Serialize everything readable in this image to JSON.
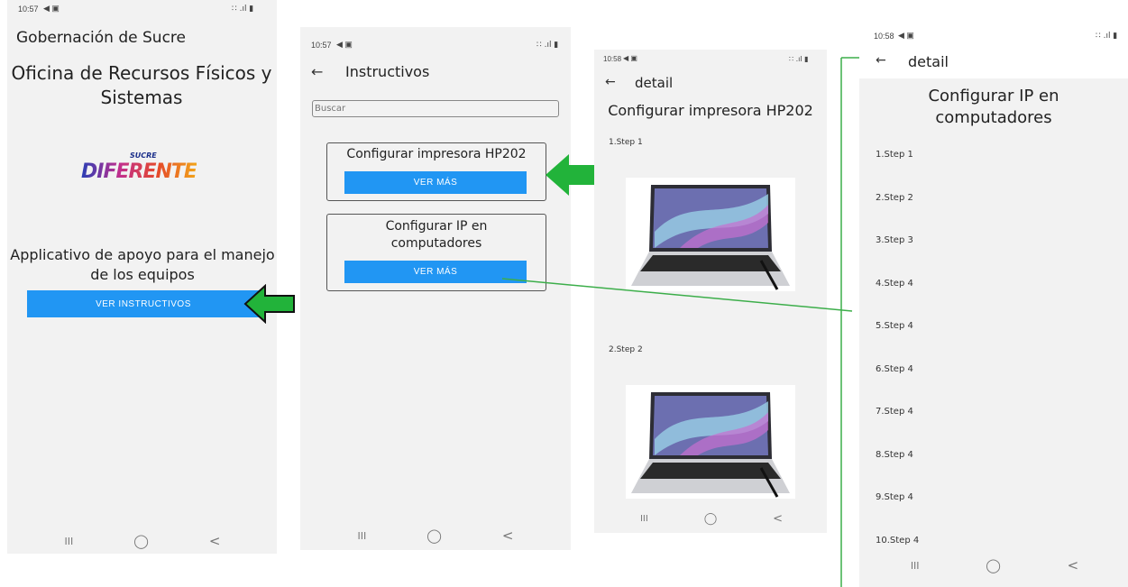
{
  "screen1": {
    "time": "10:57",
    "status_icons": "∷ .ıl ▮",
    "header": "Gobernación de Sucre",
    "title": "Oficina de Recursos Físicos y Sistemas",
    "logo_top": "SUCRE",
    "logo_main": "DIFERENTE",
    "subtitle": "Applicativo de apoyo para el manejo de los equipos",
    "button": "VER INSTRUCTIVOS",
    "nav": {
      "recent": "III",
      "home": "◯",
      "back": "<"
    }
  },
  "screen2": {
    "time": "10:57",
    "status_icons": "∷ .ıl ▮",
    "back_arrow": "←",
    "title": "Instructivos",
    "search_placeholder": "Buscar",
    "cards": [
      {
        "title": "Configurar impresora HP202",
        "button": "VER MÁS"
      },
      {
        "title": "Configurar IP en computadores",
        "button": "VER MÁS"
      }
    ],
    "nav": {
      "recent": "III",
      "home": "◯",
      "back": "<"
    }
  },
  "screen3": {
    "time": "10:58",
    "status_icons": "∷ .ıl ▮",
    "back_arrow": "←",
    "title": "detail",
    "heading": "Configurar impresora HP202",
    "steps": [
      "1.Step 1",
      "2.Step 2"
    ],
    "nav": {
      "recent": "III",
      "home": "◯",
      "back": "<"
    }
  },
  "screen4": {
    "time": "10:58",
    "status_icons": "∷ .ıl ▮",
    "back_arrow": "←",
    "title": "detail",
    "heading": "Configurar IP en computadores",
    "steps": [
      "1.Step 1",
      "2.Step 2",
      "3.Step 3",
      "4.Step 4",
      "5.Step 4",
      "6.Step 4",
      "7.Step 4",
      "8.Step 4",
      "9.Step 4",
      "10.Step 4"
    ],
    "nav": {
      "recent": "III",
      "home": "◯",
      "back": "<"
    }
  },
  "colors": {
    "accent": "#2196f3",
    "arrow_green": "#22b33a",
    "line_green": "#3cae4a"
  }
}
